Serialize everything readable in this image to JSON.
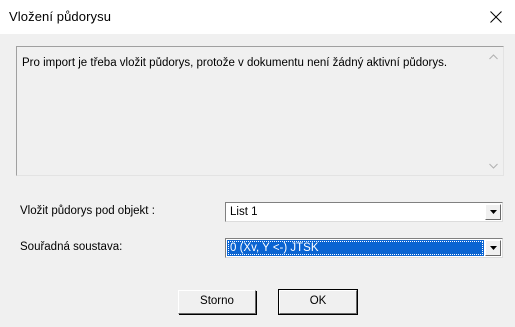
{
  "window": {
    "title": "Vložení půdorysu"
  },
  "message": {
    "text": "Pro import je třeba vložit půdorys, protože v dokumentu není žádný aktivní půdorys."
  },
  "fields": {
    "object_label": "Vložit půdorys pod objekt :",
    "object_value": "List 1",
    "coords_label": "Souřadná soustava:",
    "coords_value": "0 (Xv,  Y <-) JTSK"
  },
  "buttons": {
    "cancel": "Storno",
    "ok": "OK"
  },
  "colors": {
    "selection": "#0a64d2",
    "dialog_bg": "#f0f0f0"
  }
}
